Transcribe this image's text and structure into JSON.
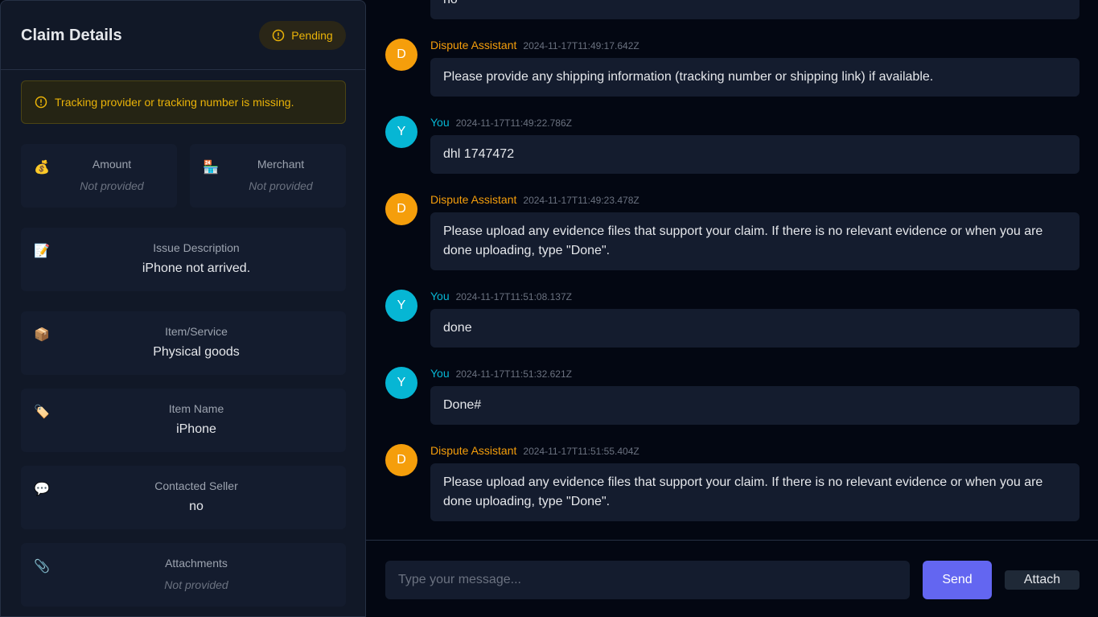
{
  "sidebar": {
    "title": "Claim Details",
    "status": "Pending",
    "warning": "Tracking provider or tracking number is missing.",
    "cards": {
      "amount": {
        "icon": "💰",
        "label": "Amount",
        "value": "Not provided"
      },
      "merchant": {
        "icon": "🏪",
        "label": "Merchant",
        "value": "Not provided"
      },
      "issue": {
        "icon": "📝",
        "label": "Issue Description",
        "value": "iPhone not arrived."
      },
      "item_service": {
        "icon": "📦",
        "label": "Item/Service",
        "value": "Physical goods"
      },
      "item_name": {
        "icon": "🏷️",
        "label": "Item Name",
        "value": "iPhone"
      },
      "contacted": {
        "icon": "💬",
        "label": "Contacted Seller",
        "value": "no"
      },
      "attachments": {
        "icon": "📎",
        "label": "Attachments",
        "value": "Not provided"
      }
    }
  },
  "chat": {
    "top_fragment": "no",
    "messages": [
      {
        "avatar": "D",
        "sender": "Dispute Assistant",
        "time": "2024-11-17T11:49:17.642Z",
        "text": "Please provide any shipping information (tracking number or shipping link) if available."
      },
      {
        "avatar": "Y",
        "sender": "You",
        "time": "2024-11-17T11:49:22.786Z",
        "text": "dhl 1747472"
      },
      {
        "avatar": "D",
        "sender": "Dispute Assistant",
        "time": "2024-11-17T11:49:23.478Z",
        "text": "Please upload any evidence files that support your claim. If there is no relevant evidence or when you are done uploading, type \"Done\"."
      },
      {
        "avatar": "Y",
        "sender": "You",
        "time": "2024-11-17T11:51:08.137Z",
        "text": "done"
      },
      {
        "avatar": "Y",
        "sender": "You",
        "time": "2024-11-17T11:51:32.621Z",
        "text": "Done#"
      },
      {
        "avatar": "D",
        "sender": "Dispute Assistant",
        "time": "2024-11-17T11:51:55.404Z",
        "text": "Please upload any evidence files that support your claim. If there is no relevant evidence or when you are done uploading, type \"Done\"."
      }
    ]
  },
  "composer": {
    "placeholder": "Type your message...",
    "send_label": "Send",
    "attach_label": "Attach"
  },
  "colors": {
    "assistant": "#f59e0b",
    "user": "#06b6d4",
    "pending": "#eab308",
    "send": "#6366f1"
  }
}
